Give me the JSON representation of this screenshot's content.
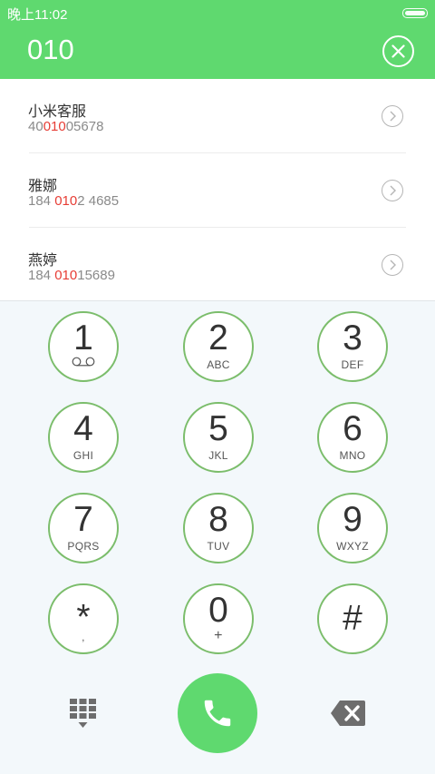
{
  "status_bar": {
    "time": "晚上11:02"
  },
  "header": {
    "dialed_number": "010"
  },
  "results": [
    {
      "name": "小米客服",
      "number_pre": "40",
      "number_match": "010",
      "number_post": "05678"
    },
    {
      "name": "雅娜",
      "number_pre": "184 ",
      "number_match": "010",
      "number_post": "2 4685"
    },
    {
      "name": "燕婷",
      "number_pre": "184 ",
      "number_match": "010",
      "number_post": "15689"
    }
  ],
  "keypad": [
    {
      "digit": "1",
      "letters": ""
    },
    {
      "digit": "2",
      "letters": "ABC"
    },
    {
      "digit": "3",
      "letters": "DEF"
    },
    {
      "digit": "4",
      "letters": "GHI"
    },
    {
      "digit": "5",
      "letters": "JKL"
    },
    {
      "digit": "6",
      "letters": "MNO"
    },
    {
      "digit": "7",
      "letters": "PQRS"
    },
    {
      "digit": "8",
      "letters": "TUV"
    },
    {
      "digit": "9",
      "letters": "WXYZ"
    },
    {
      "digit": "*",
      "letters": ","
    },
    {
      "digit": "0",
      "letters": "+"
    },
    {
      "digit": "#",
      "letters": ""
    }
  ],
  "colors": {
    "accent": "#5fd96f",
    "key_border": "#7bbd6b",
    "match_highlight": "#e73d35"
  },
  "icons": {
    "clear": "close-icon",
    "detail": "chevron-right-icon",
    "voicemail": "voicemail-icon",
    "keypad_toggle": "dialpad-icon",
    "call": "phone-icon",
    "delete": "backspace-icon"
  }
}
